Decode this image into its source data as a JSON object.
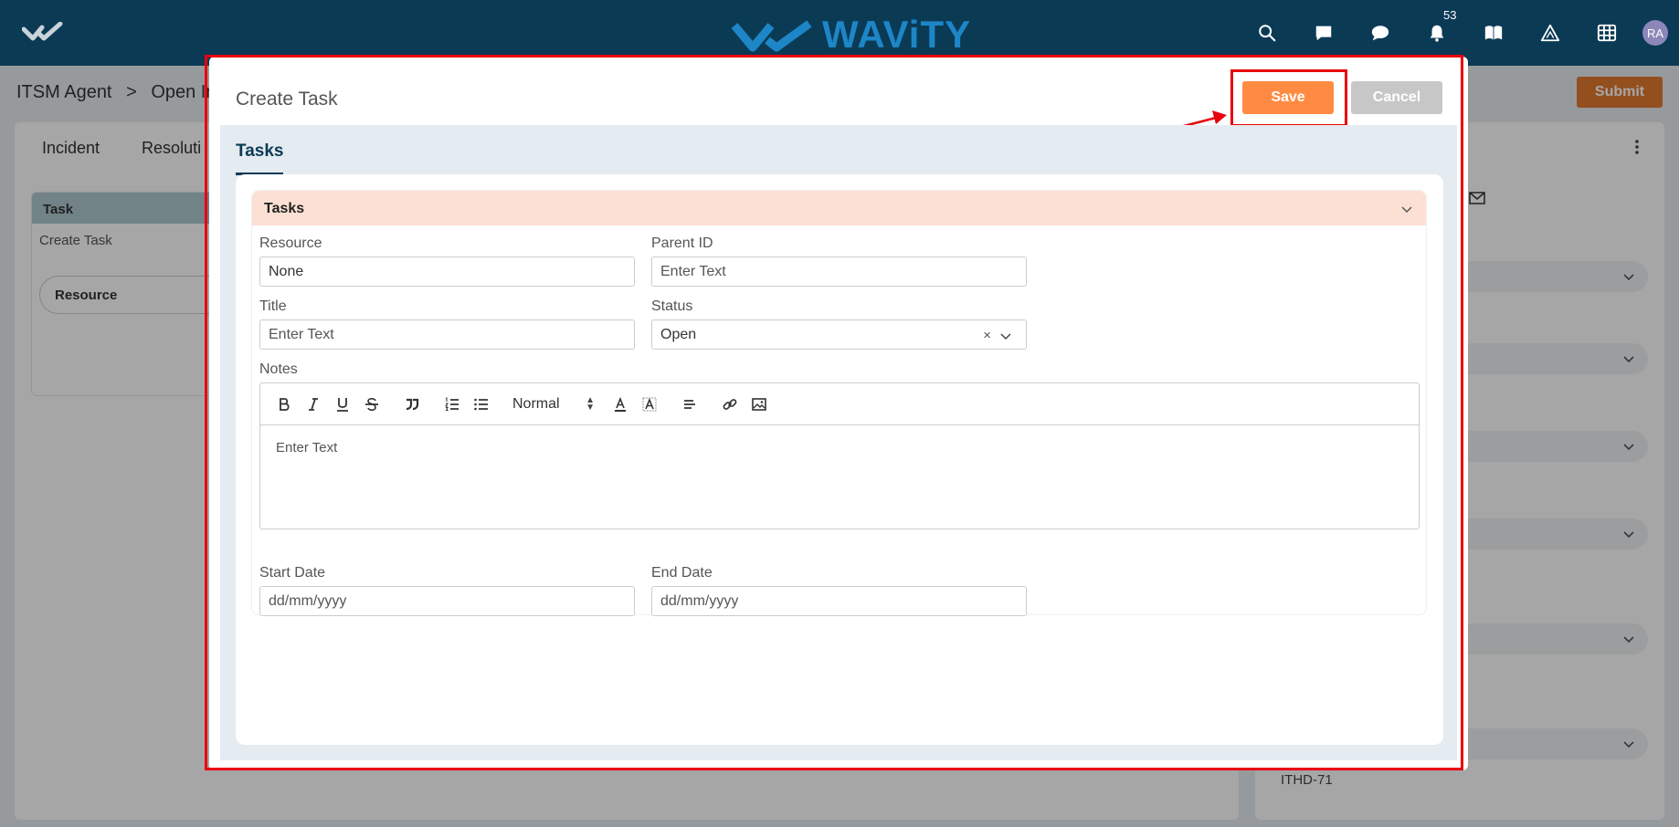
{
  "topbar": {
    "brand": "WAViTY",
    "notification_count": "53",
    "avatar_initials": "RA",
    "icons": [
      "home-check-icon",
      "search-icon",
      "chat-square-icon",
      "chat-bubble-icon",
      "bell-icon",
      "book-icon",
      "triangle-ai-icon",
      "grid-icon"
    ]
  },
  "background": {
    "breadcrumb_root": "ITSM Agent",
    "breadcrumb_sep": ">",
    "breadcrumb_current": "Open Inc",
    "submit_label": "Submit",
    "tabs": [
      "Incident",
      "Resoluti"
    ],
    "task_panel_title": "Task",
    "task_panel_item": "Create Task",
    "task_panel_resource": "Resource",
    "right_footer_text": "ITHD-71"
  },
  "modal": {
    "title": "Create Task",
    "save_label": "Save",
    "cancel_label": "Cancel",
    "tab_label": "Tasks",
    "section_title": "Tasks",
    "fields": {
      "resource": {
        "label": "Resource",
        "value": "None"
      },
      "parent_id": {
        "label": "Parent ID",
        "placeholder": "Enter Text"
      },
      "title": {
        "label": "Title",
        "placeholder": "Enter Text"
      },
      "status": {
        "label": "Status",
        "value": "Open",
        "clear": "×"
      },
      "notes": {
        "label": "Notes",
        "placeholder": "Enter Text",
        "format": "Normal"
      },
      "start_date": {
        "label": "Start Date",
        "placeholder": "dd/mm/yyyy"
      },
      "end_date": {
        "label": "End Date",
        "placeholder": "dd/mm/yyyy"
      }
    }
  },
  "colors": {
    "topbar": "#0b3a55",
    "brand": "#1d86c7",
    "save": "#ff8b43",
    "cancel": "#c7c7c7",
    "submit": "#e27a2f",
    "section_header": "#fde0d4",
    "annotation": "#e8000d"
  }
}
